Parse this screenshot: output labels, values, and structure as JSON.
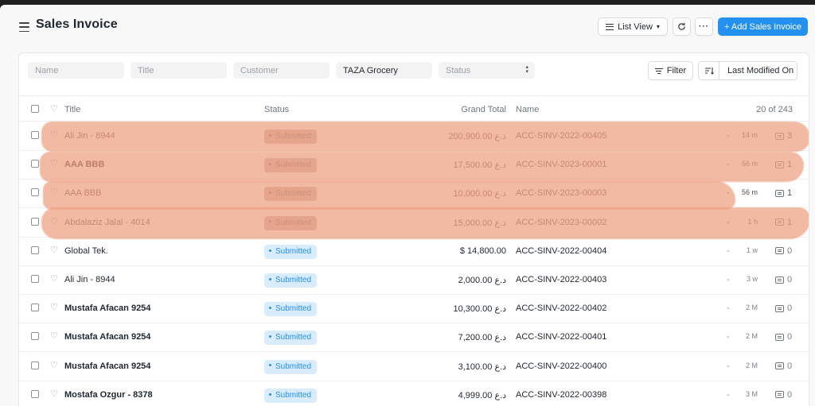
{
  "header": {
    "title": "Sales Invoice",
    "list_view_label": "List View",
    "add_label": "+ Add Sales Invoice",
    "more_label": "···"
  },
  "filters": {
    "name_placeholder": "Name",
    "title_placeholder": "Title",
    "customer_placeholder": "Customer",
    "taza_value": "TAZA Grocery",
    "status_placeholder": "Status",
    "filter_label": "Filter",
    "sort_label": "Last Modified On"
  },
  "table": {
    "headers": {
      "title": "Title",
      "status": "Status",
      "grand_total": "Grand Total",
      "name": "Name",
      "count": "20 of 243"
    },
    "rows": [
      {
        "title": "Ali Jin - 8944",
        "status": "Submitted",
        "total": "200,900.00 د.ع",
        "name": "ACC-SINV-2022-00405",
        "dash": "-",
        "time": "14 m",
        "comments": "3"
      },
      {
        "title": "AAA BBB",
        "status": "Submitted",
        "total": "17,500.00 د.ع",
        "name": "ACC-SINV-2023-00001",
        "dash": "-",
        "time": "56 m",
        "comments": "1"
      },
      {
        "title": "AAA BBB",
        "status": "Submitted",
        "total": "10,000.00 د.ع",
        "name": "ACC-SINV-2023-00003",
        "dash": "-",
        "time": "56 m",
        "comments": "1"
      },
      {
        "title": "Abdalaziz Jalal - 4014",
        "status": "Submitted",
        "total": "15,000.00 د.ع",
        "name": "ACC-SINV-2023-00002",
        "dash": "-",
        "time": "1 h",
        "comments": "1"
      },
      {
        "title": "Global Tek.",
        "status": "Submitted",
        "total": "$ 14,800.00",
        "name": "ACC-SINV-2022-00404",
        "dash": "-",
        "time": "1 w",
        "comments": "0"
      },
      {
        "title": "Ali Jin - 8944",
        "status": "Submitted",
        "total": "2,000.00 د.ع",
        "name": "ACC-SINV-2022-00403",
        "dash": "-",
        "time": "3 w",
        "comments": "0"
      },
      {
        "title": "Mustafa Afacan 9254",
        "status": "Submitted",
        "total": "10,300.00 د.ع",
        "name": "ACC-SINV-2022-00402",
        "dash": "-",
        "time": "2 M",
        "comments": "0"
      },
      {
        "title": "Mustafa Afacan 9254",
        "status": "Submitted",
        "total": "7,200.00 د.ع",
        "name": "ACC-SINV-2022-00401",
        "dash": "-",
        "time": "2 M",
        "comments": "0"
      },
      {
        "title": "Mustafa Afacan 9254",
        "status": "Submitted",
        "total": "3,100.00 د.ع",
        "name": "ACC-SINV-2022-00400",
        "dash": "-",
        "time": "2 M",
        "comments": "0"
      },
      {
        "title": "Mostafa Ozgur - 8378",
        "status": "Submitted",
        "total": "4,999.00 د.ع",
        "name": "ACC-SINV-2022-00398",
        "dash": "-",
        "time": "3 M",
        "comments": "0"
      }
    ]
  },
  "colors": {
    "accent": "#2490ef",
    "status_bg": "#d9ecfc",
    "redaction": "#eea080"
  }
}
